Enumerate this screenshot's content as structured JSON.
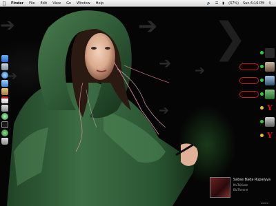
{
  "menubar": {
    "apple_icon": "apple-icon",
    "items": [
      "Finder",
      "File",
      "Edit",
      "View",
      "Go",
      "Window",
      "Help"
    ],
    "battery": "(37%)",
    "clock": "Sun 6:16 PM",
    "status_icons": [
      "volume-icon",
      "wifi-icon",
      "battery-icon",
      "spotlight-icon"
    ]
  },
  "now_playing": {
    "title": "Sabse Bada Rupaiyya",
    "artist": "MuTeitiuke",
    "album": "BlaThenne",
    "extra": "dsfdre"
  },
  "colors": {
    "hood": "#2f5a36",
    "accent_red": "#c02020",
    "yahoo": "#d0101a"
  }
}
